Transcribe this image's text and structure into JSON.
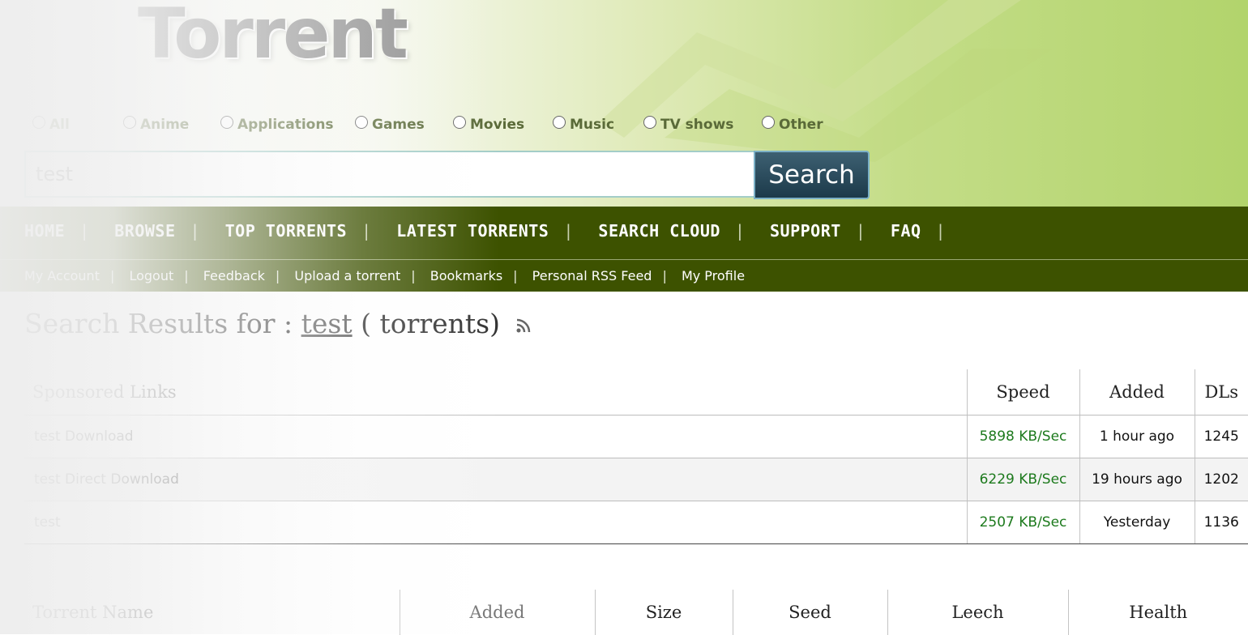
{
  "header": {
    "logo_text": "Torrent",
    "categories": [
      "All",
      "Anime",
      "Applications",
      "Games",
      "Movies",
      "Music",
      "TV shows",
      "Other"
    ],
    "search_value": "test",
    "search_button": "Search"
  },
  "nav": {
    "main": [
      "HOME",
      "BROWSE",
      "TOP TORRENTS",
      "LATEST TORRENTS",
      "SEARCH CLOUD",
      "SUPPORT",
      "FAQ"
    ],
    "sub": [
      "My Account",
      "Logout",
      "Feedback",
      "Upload a torrent",
      "Bookmarks",
      "Personal RSS Feed",
      "My Profile"
    ]
  },
  "results": {
    "prefix": "Search Results for :",
    "query": "test",
    "suffix": "( torrents)",
    "rss_icon": "rss-icon"
  },
  "sponsored": {
    "headers": [
      "Sponsored Links",
      "Speed",
      "Added",
      "DLs"
    ],
    "rows": [
      {
        "name": "test Download",
        "speed": "5898 KB/Sec",
        "added": "1 hour ago",
        "dls": "1245"
      },
      {
        "name": "test Direct Download",
        "speed": "6229 KB/Sec",
        "added": "19 hours ago",
        "dls": "1202"
      },
      {
        "name": "test",
        "speed": "2507 KB/Sec",
        "added": "Yesterday",
        "dls": "1136"
      }
    ]
  },
  "torrents": {
    "headers": [
      "Torrent Name",
      "Added",
      "Size",
      "Seed",
      "Leech",
      "Health"
    ]
  },
  "colors": {
    "nav_bg": "#3d5200",
    "search_button": "#2b4a5b",
    "speed_text": "#1d7a1d"
  }
}
